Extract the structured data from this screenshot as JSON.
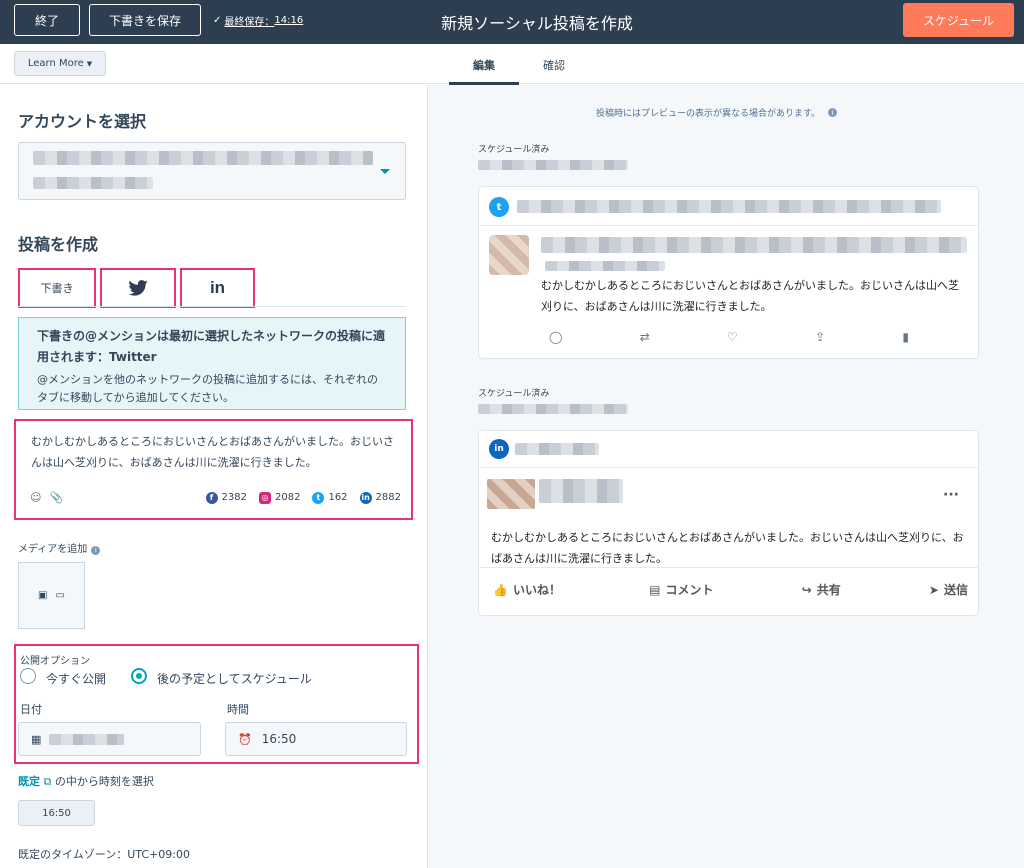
{
  "topbar": {
    "exit_label": "終了",
    "save_draft_label": "下書きを保存",
    "last_saved_label": "最終保存：",
    "last_saved_time": "14:16",
    "title": "新規ソーシャル投稿を作成",
    "schedule_label": "スケジュール"
  },
  "subbar": {
    "learn_more_label": "Learn More",
    "tabs": [
      {
        "label": "編集",
        "active": true
      },
      {
        "label": "確認",
        "active": false
      }
    ]
  },
  "compose": {
    "account_heading": "アカウントを選択",
    "post_heading": "投稿を作成",
    "network_tabs": [
      {
        "label": "下書き",
        "icon": "draft"
      },
      {
        "label": "",
        "icon": "twitter-icon"
      },
      {
        "label": "",
        "icon": "linkedin-icon"
      }
    ],
    "info_title": "下書きの@メンションは最初に選択したネットワークの投稿に適用されます：Twitter",
    "info_body": "@メンションを他のネットワークの投稿に追加するには、それぞれのタブに移動してから追加してください。",
    "post_text": "むかしむかしあるところにおじいさんとおばあさんがいました。おじいさんは山へ芝刈りに、おばあさんは川に洗濯に行きました。",
    "char_counts": {
      "facebook": "2382",
      "instagram": "2082",
      "twitter": "162",
      "linkedin": "2882"
    },
    "add_media_label": "メディアを追加",
    "publish_options_label": "公開オプション",
    "publish_now_label": "今すぐ公開",
    "schedule_later_label": "後の予定としてスケジュール",
    "date_label": "日付",
    "time_label": "時間",
    "time_value": "16:50",
    "preset_link": "既定",
    "preset_suffix": "の中から時刻を選択",
    "preset_chip": "16:50",
    "timezone_label": "既定のタイムゾーン：UTC+09:00"
  },
  "preview": {
    "note": "投稿時にはプレビューの表示が異なる場合があります。",
    "twitter_status": "スケジュール済み",
    "linkedin_status": "スケジュール済み",
    "twitter_text": "むかしむかしあるところにおじいさんとおばあさんがいました。おじいさんは山へ芝刈りに、おばあさんは川に洗濯に行きました。",
    "linkedin_text": "むかしむかしあるところにおじいさんとおばあさんがいました。おじいさんは山へ芝刈りに、おばあさんは川に洗濯に行きました。",
    "li_actions": {
      "like": "いいね！",
      "comment": "コメント",
      "share": "共有",
      "send": "送信"
    }
  },
  "colors": {
    "topbar": "#2d3e50",
    "schedule_button": "#ff7a59",
    "highlight": "#e8336f",
    "teal": "#00a4bd",
    "twitter": "#1da1f2",
    "linkedin": "#0a66c2"
  }
}
